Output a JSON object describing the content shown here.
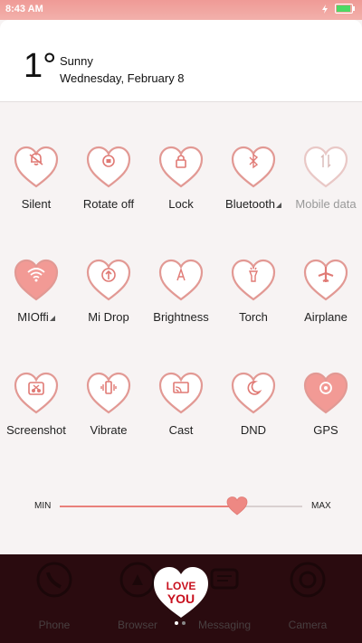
{
  "status_bar": {
    "time": "8:43 AM"
  },
  "date_card": {
    "temperature": "1°",
    "weather": "Sunny",
    "date": "Wednesday, February 8"
  },
  "tiles": [
    {
      "label": "Silent",
      "icon": "bell-off-icon",
      "active": false
    },
    {
      "label": "Rotate off",
      "icon": "rotate-lock-icon",
      "active": false
    },
    {
      "label": "Lock",
      "icon": "lock-icon",
      "active": false
    },
    {
      "label": "Bluetooth",
      "icon": "bluetooth-icon",
      "active": false,
      "expandable": true
    },
    {
      "label": "Mobile data",
      "icon": "mobile-data-icon",
      "active": false,
      "disabled": true
    },
    {
      "label": "MIOffi",
      "icon": "wifi-icon",
      "active": true,
      "expandable": true
    },
    {
      "label": "Mi Drop",
      "icon": "mi-drop-icon",
      "active": false
    },
    {
      "label": "Brightness",
      "icon": "brightness-auto-icon",
      "active": false
    },
    {
      "label": "Torch",
      "icon": "torch-icon",
      "active": false
    },
    {
      "label": "Airplane",
      "icon": "airplane-icon",
      "active": false
    },
    {
      "label": "Screenshot",
      "icon": "scissors-icon",
      "active": false
    },
    {
      "label": "Vibrate",
      "icon": "vibrate-icon",
      "active": false
    },
    {
      "label": "Cast",
      "icon": "cast-icon",
      "active": false
    },
    {
      "label": "DND",
      "icon": "moon-icon",
      "active": false
    },
    {
      "label": "GPS",
      "icon": "location-icon",
      "active": true
    }
  ],
  "brightness": {
    "min_label": "MIN",
    "max_label": "MAX",
    "level": 0.73
  },
  "dock": {
    "items": [
      "Phone",
      "Browser",
      "Messaging",
      "Camera"
    ],
    "overlay_text": [
      "LOVE",
      "YOU"
    ]
  },
  "colors": {
    "accent": "#e9807b",
    "outline": "#e29994",
    "dock": "#2a0b0f"
  }
}
